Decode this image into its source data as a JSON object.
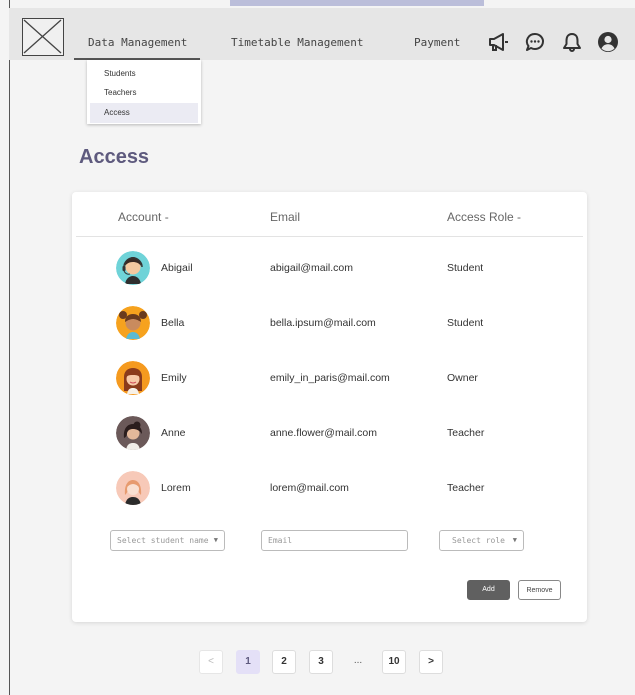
{
  "nav": {
    "tabs": [
      {
        "label": "Data Management",
        "active": true
      },
      {
        "label": "Timetable Management",
        "active": false
      },
      {
        "label": "Payment",
        "active": false
      }
    ],
    "icons": [
      "megaphone-icon",
      "chat-icon",
      "bell-icon",
      "user-account-icon"
    ]
  },
  "dropdown": {
    "items": [
      {
        "label": "Students",
        "selected": false
      },
      {
        "label": "Teachers",
        "selected": false
      },
      {
        "label": "Access",
        "selected": true
      }
    ]
  },
  "page": {
    "title": "Access"
  },
  "table": {
    "headers": {
      "account": "Account -",
      "email": "Email",
      "role": "Access Role -"
    },
    "rows": [
      {
        "name": "Abigail",
        "email": "abigail@mail.com",
        "role": "Student",
        "avatar": "avatar-abigail"
      },
      {
        "name": "Bella",
        "email": "bella.ipsum@mail.com",
        "role": "Student",
        "avatar": "avatar-bella"
      },
      {
        "name": "Emily",
        "email": "emily_in_paris@mail.com",
        "role": "Owner",
        "avatar": "avatar-emily"
      },
      {
        "name": "Anne",
        "email": "anne.flower@mail.com",
        "role": "Teacher",
        "avatar": "avatar-anne"
      },
      {
        "name": "Lorem",
        "email": "lorem@mail.com",
        "role": "Teacher",
        "avatar": "avatar-lorem"
      }
    ]
  },
  "form": {
    "student_placeholder": "Select student name",
    "email_placeholder": "Email",
    "role_placeholder": "Select role",
    "caret": "▼",
    "add_label": "Add",
    "remove_label": "Remove"
  },
  "pagination": {
    "prev": "<",
    "pages": [
      "1",
      "2",
      "3"
    ],
    "ellipsis": "...",
    "last": "10",
    "next": ">",
    "current": "1"
  },
  "colors": {
    "accent": "#5e5a7e",
    "active_page_bg": "#e4e0f7",
    "add_button": "#606060"
  }
}
